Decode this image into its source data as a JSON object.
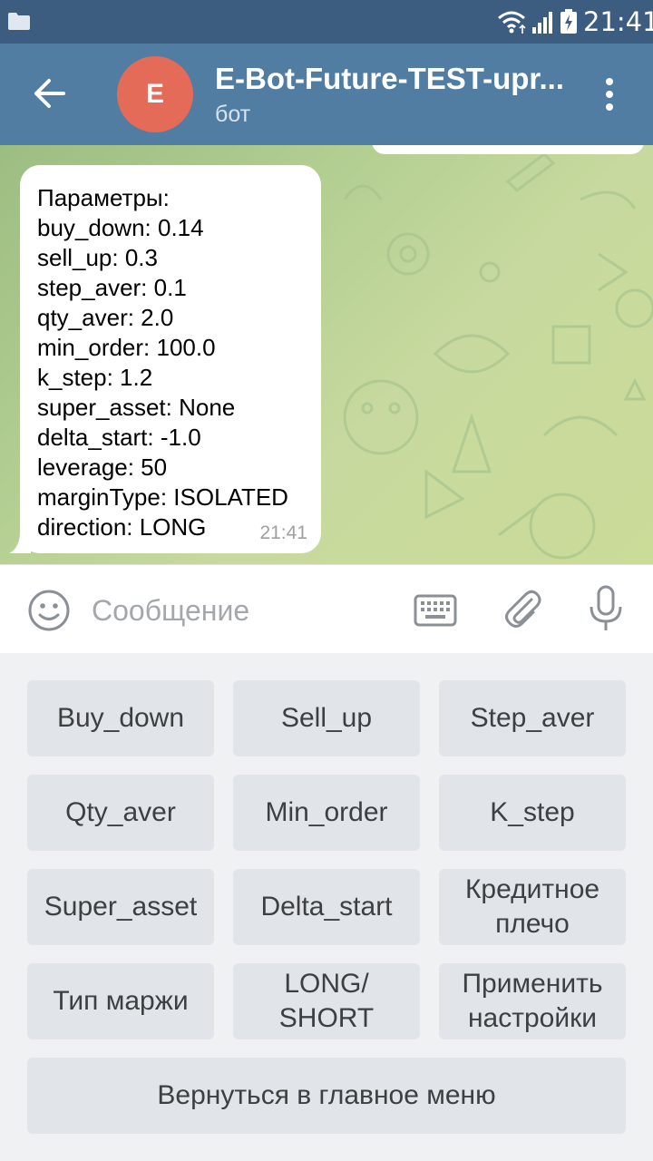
{
  "status_bar": {
    "time": "21:41"
  },
  "header": {
    "avatar_letter": "E",
    "title": "E-Bot-Future-TEST-upr...",
    "subtitle": "бот"
  },
  "message": {
    "lines": [
      "Параметры:",
      "buy_down: 0.14",
      "sell_up: 0.3",
      "step_aver: 0.1",
      "qty_aver: 2.0",
      "min_order: 100.0",
      "k_step: 1.2",
      "super_asset: None",
      "delta_start: -1.0",
      "leverage: 50",
      "marginType: ISOLATED",
      "direction: LONG"
    ],
    "time": "21:41"
  },
  "input": {
    "placeholder": "Сообщение"
  },
  "keyboard": {
    "buttons": [
      "Buy_down",
      "Sell_up",
      "Step_aver",
      "Qty_aver",
      "Min_order",
      "K_step",
      "Super_asset",
      "Delta_start",
      "Кредитное плечо",
      "Тип маржи",
      "LONG/ SHORT",
      "Применить настройки",
      "Вернуться в главное меню"
    ]
  },
  "colors": {
    "status_bar": "#3d5d80",
    "header": "#527da3",
    "avatar": "#e46b57",
    "keyboard_bg": "#f0f1f3",
    "button_bg": "#e1e4e8"
  }
}
